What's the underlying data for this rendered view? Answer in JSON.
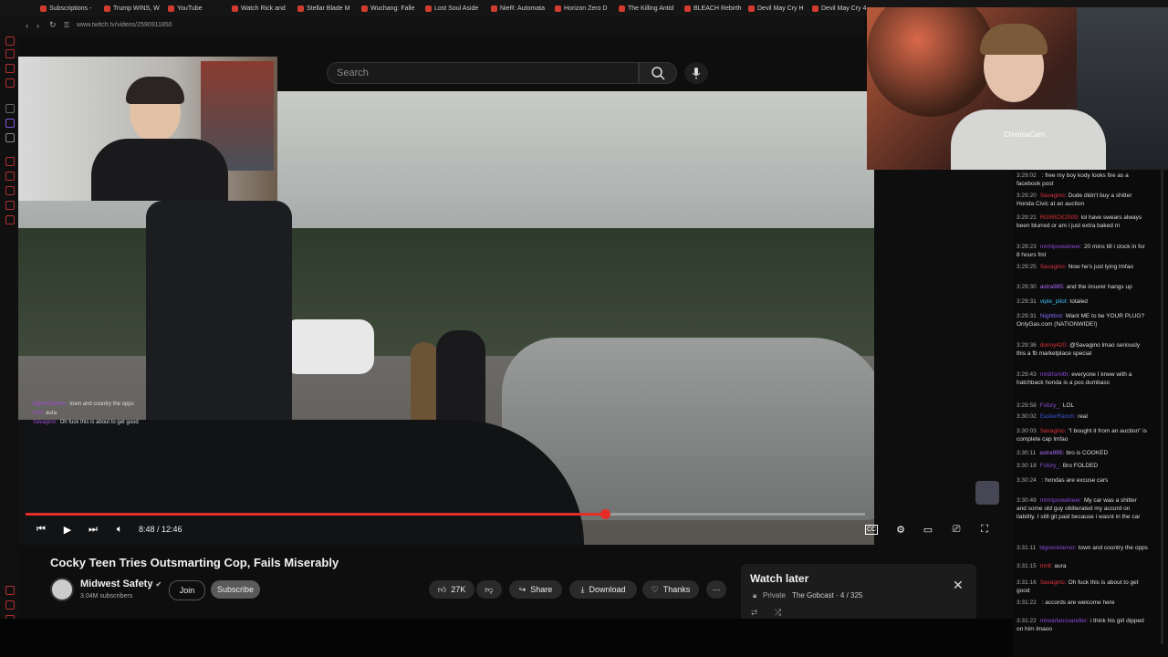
{
  "browser": {
    "url": "www.twitch.tv/videos/2590911850",
    "tabs": [
      {
        "label": "Subscriptions - "
      },
      {
        "label": "Trump WINS, W"
      },
      {
        "label": "YouTube"
      },
      {
        "label": "Watch Rick and"
      },
      {
        "label": "Stellar Blade M"
      },
      {
        "label": "Wuchang: Falle"
      },
      {
        "label": "Lost Soul Aside"
      },
      {
        "label": "NieR: Automata"
      },
      {
        "label": "Horizon Zero D"
      },
      {
        "label": "The Killing Antid"
      },
      {
        "label": "BLEACH Rebirth"
      },
      {
        "label": "Devil May Cry H"
      },
      {
        "label": "Devil May Cry 4"
      }
    ]
  },
  "youtube": {
    "search_placeholder": "Search",
    "video": {
      "title": "Cocky Teen Tries Outsmarting Cop, Fails Miserably",
      "time": "8:48 / 12:46",
      "progress": 0.69
    },
    "channel": {
      "name": "Midwest Safety",
      "subscribers": "3.04M subscribers",
      "join_label": "Join",
      "subscribe_label": "Subscribe"
    },
    "actions": {
      "likes": "27K",
      "share": "Share",
      "download": "Download",
      "thanks": "Thanks"
    },
    "watch_later": {
      "title": "Watch later",
      "privacy": "Private",
      "owner": "The Gobcast · 4 / 325"
    }
  },
  "webcam": {
    "label": "ChromaCam"
  },
  "overlay_chat": [
    {
      "name": "bignecklamer:",
      "text": "town and country the opps"
    },
    {
      "name": "tnnll",
      "text": "aura"
    },
    {
      "name": "Savagino:",
      "text": "Oh fuck this is about to get good"
    }
  ],
  "chat": [
    {
      "ts": "3:29:02",
      "name": "",
      "color": "#ffffff",
      "text": ": free my boy kody looks fire as a facebook post"
    },
    {
      "ts": "3:29:20",
      "name": "Savagino:",
      "color": "#e0323b",
      "text": "Dude didn't buy a shitter Honda Civic at an auction"
    },
    {
      "ts": "3:29:21",
      "name": "RGWICK2009:",
      "color": "#e0323b",
      "text": "lol have swears always been blurred or am i just extra baked rn"
    },
    {
      "ts": "3:29:23",
      "name": "mrmipowalneer:",
      "color": "#8a4bd6",
      "text": "20 mins till i clock in for 8 hours fml"
    },
    {
      "ts": "3:29:25",
      "name": "Savagino:",
      "color": "#e0323b",
      "text": "Now he's just lying lmfao"
    },
    {
      "ts": "3:29:30",
      "name": "astra985:",
      "color": "#b06bff",
      "text": "and the insurer hangs up"
    },
    {
      "ts": "3:29:31",
      "name": "viple_pilot:",
      "color": "#3ec0f0",
      "text": "totaled"
    },
    {
      "ts": "3:29:31",
      "name": "Nightbot:",
      "color": "#7b6cf0",
      "text": "Want ME to be YOUR PLUG? OnlyGas.com (NATIONWIDE!)"
    },
    {
      "ts": "3:29:36",
      "name": "donny420:",
      "color": "#e0323b",
      "text": "@Savagino lmao seriously this a fb marketplace special"
    },
    {
      "ts": "3:29:43",
      "name": "mrdrtsmith:",
      "color": "#8a4bd6",
      "text": "everyone I knew with a hatchback honda is a pos dumbass"
    },
    {
      "ts": "3:29:58",
      "name": "Fobzy_:",
      "color": "#8a4bd6",
      "text": "LOL"
    },
    {
      "ts": "3:30:02",
      "name": "EasterRanch:",
      "color": "#3a56d6",
      "text": "real"
    },
    {
      "ts": "3:30:03",
      "name": "Savagino:",
      "color": "#e0323b",
      "text": "\"I bought it from an auction\" is complete cap lmfao"
    },
    {
      "ts": "3:30:11",
      "name": "astra985:",
      "color": "#b06bff",
      "text": "bro is COOKED"
    },
    {
      "ts": "3:30:18",
      "name": "Fobzy_:",
      "color": "#8a4bd6",
      "text": "Bro FOLDED"
    },
    {
      "ts": "3:30:24",
      "name": "",
      "color": "#ffffff",
      "text": ": hondas are excuse cars"
    },
    {
      "ts": "3:30:49",
      "name": "mrmipowalneer:",
      "color": "#8a4bd6",
      "text": "My car was a shitter and some old guy obliterated my accord on liability. I still git paid because i wasnt in the car"
    },
    {
      "ts": "3:31:11",
      "name": "bignecklamer:",
      "color": "#8a4bd6",
      "text": "town and country the opps"
    },
    {
      "ts": "3:31:15",
      "name": "tnnll:",
      "color": "#e0323b",
      "text": "aura"
    },
    {
      "ts": "3:31:16",
      "name": "Savagino:",
      "color": "#e0323b",
      "text": "Oh fuck this is about to get good"
    },
    {
      "ts": "3:31:22",
      "name": "",
      "color": "#ffffff",
      "text": ": accords are welcome here"
    },
    {
      "ts": "3:31:22",
      "name": "mrwarlanssandler:",
      "color": "#8a4bd6",
      "text": "i think his girl dipped on him lmaoo"
    }
  ]
}
